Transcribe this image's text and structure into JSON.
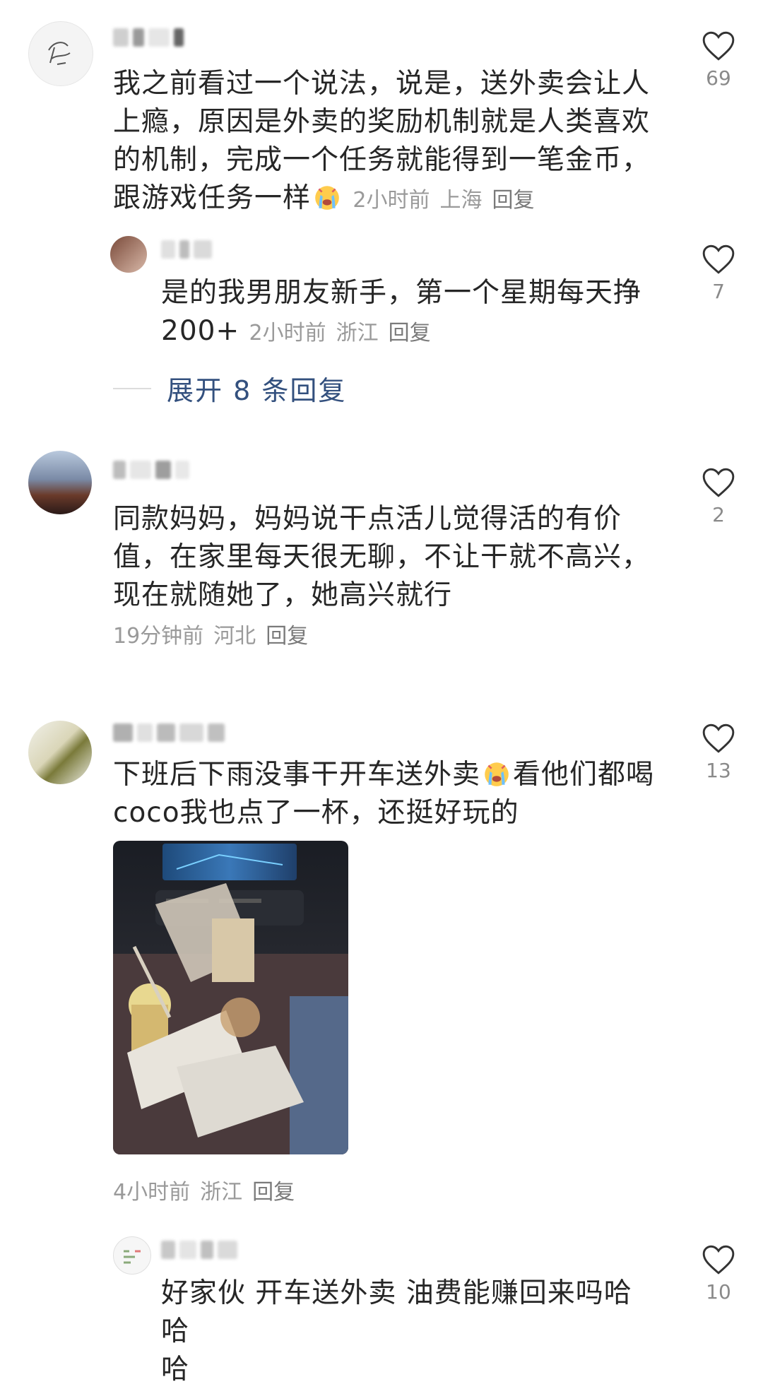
{
  "comments": [
    {
      "text": "我之前看过一个说法，说是，送外卖会让人上瘾，原因是外卖的奖励机制就是人类喜欢的机制，完成一个任务就能得到一笔金币，跟游戏任务一样",
      "lines": [
        "我之前看过一个说法，说是，送外卖会让人",
        "上瘾，原因是外卖的奖励机制就是人类喜欢",
        "的机制，完成一个任务就能得到一笔金币，",
        "跟游戏任务一样"
      ],
      "emoji": "crying-face-emoji",
      "time": "2小时前",
      "location": "上海",
      "reply": "回复",
      "likes": "69",
      "replies": [
        {
          "lines": [
            "是的我男朋友新手，第一个星期每天挣",
            "200+"
          ],
          "time": "2小时前",
          "location": "浙江",
          "reply": "回复",
          "likes": "7"
        }
      ],
      "expand_label": "展开 8 条回复"
    },
    {
      "lines": [
        "同款妈妈，妈妈说干点活儿觉得活的有价",
        "值，在家里每天很无聊，不让干就不高兴，",
        "现在就随她了，她高兴就行"
      ],
      "time": "19分钟前",
      "location": "河北",
      "reply": "回复",
      "likes": "2"
    },
    {
      "lines": [
        "下班后下雨没事干开车送外卖",
        "看他们都喝",
        "coco我也点了一杯，还挺好玩的"
      ],
      "emoji": "crying-face-emoji",
      "time": "4小时前",
      "location": "浙江",
      "reply": "回复",
      "likes": "13",
      "image": "car-delivery-photo",
      "replies": [
        {
          "lines": [
            "好家伙 开车送外卖 油费能赚回来吗哈哈",
            "哈"
          ],
          "likes": "10"
        }
      ]
    }
  ],
  "colors": {
    "text": "#262626",
    "meta": "#9a9a9a",
    "expand": "#33507e",
    "icon": "#333333"
  }
}
